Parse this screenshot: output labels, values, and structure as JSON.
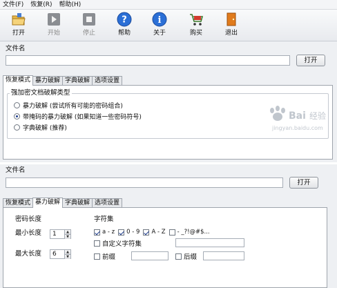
{
  "menu": [
    "文件(F)",
    "恢复(R)",
    "帮助(H)"
  ],
  "toolbar": [
    {
      "label": "打开",
      "icon": "open-folder-icon",
      "enabled": true
    },
    {
      "label": "开始",
      "icon": "play-icon",
      "enabled": false
    },
    {
      "label": "停止",
      "icon": "stop-icon",
      "enabled": false
    },
    {
      "label": "帮助",
      "icon": "help-icon",
      "enabled": true
    },
    {
      "label": "关于",
      "icon": "info-icon",
      "enabled": true
    },
    {
      "label": "购买",
      "icon": "cart-icon",
      "enabled": true
    },
    {
      "label": "退出",
      "icon": "exit-door-icon",
      "enabled": true
    }
  ],
  "file": {
    "label": "文件名",
    "value": "",
    "open_button": "打开"
  },
  "tabs": [
    "恢复模式",
    "暴力破解",
    "字典破解",
    "选项设置"
  ],
  "mode_panel": {
    "group_title": "强加密文档破解类型",
    "options": [
      {
        "label": "暴力破解 (尝试所有可能的密码组合)",
        "selected": false
      },
      {
        "label": "带掩码的暴力破解 (如果知道一些密码符号)",
        "selected": true
      },
      {
        "label": "字典破解 (推荐)",
        "selected": false
      }
    ]
  },
  "file2": {
    "label": "文件名",
    "value": "",
    "open_button": "打开"
  },
  "brute_panel": {
    "length_title": "密码长度",
    "min_label": "最小长度",
    "min_value": "1",
    "max_label": "最大长度",
    "max_value": "6",
    "charset_title": "字符集",
    "charsets": [
      {
        "label": "a - z",
        "checked": true
      },
      {
        "label": "0 - 9",
        "checked": true
      },
      {
        "label": "A - Z",
        "checked": true
      },
      {
        "label": "- _?!@#$...",
        "checked": false
      }
    ],
    "custom_label": "自定义字符集",
    "custom_checked": false,
    "prefix_label": "前缀",
    "prefix_checked": false,
    "suffix_label": "后缀",
    "suffix_checked": false
  },
  "watermark": {
    "brand": "Bai",
    "brand2": "经验",
    "url": "jingyan.baidu.com"
  },
  "colors": {
    "accent": "#1b3a8c",
    "help_blue": "#2b6fd6",
    "exit_orange": "#e07b1c"
  }
}
